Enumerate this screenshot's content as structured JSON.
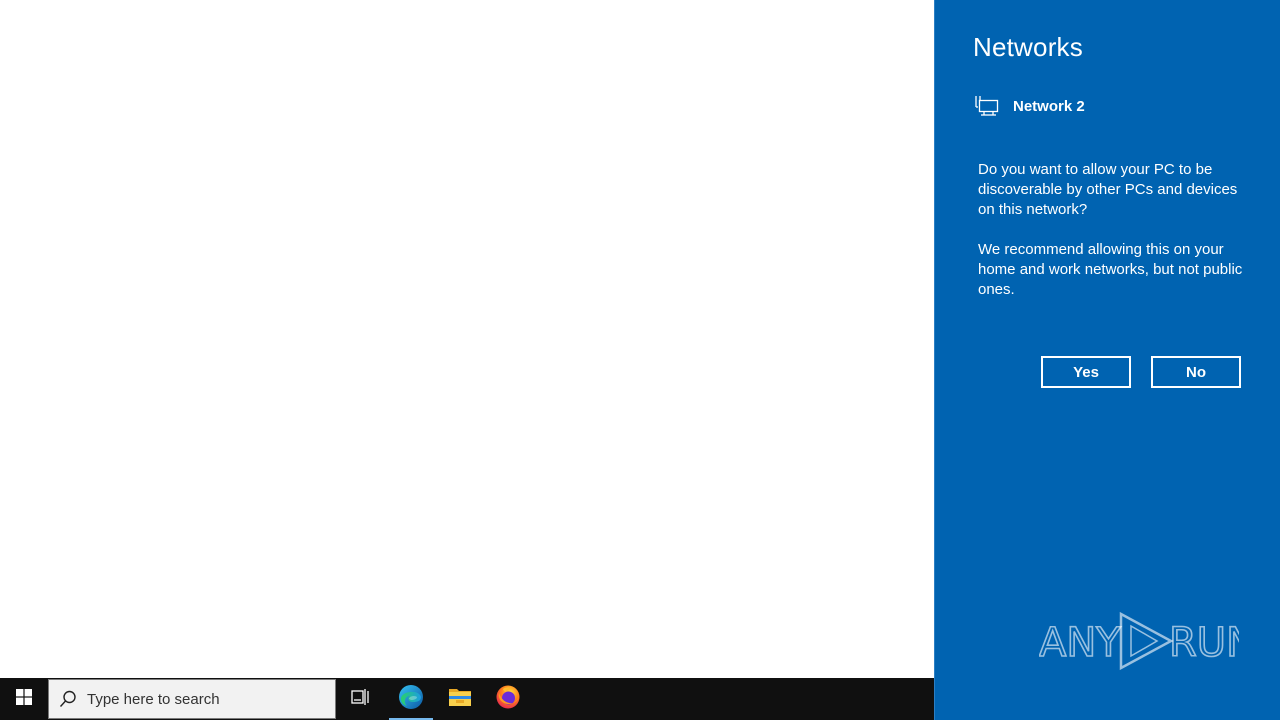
{
  "network_panel": {
    "title": "Networks",
    "network_name": "Network 2",
    "network_icon": "ethernet-icon",
    "question": "Do you want to allow your PC to be discoverable by other PCs and devices on this network?",
    "recommendation": "We recommend allowing this on your home and work networks, but not public ones.",
    "yes_label": "Yes",
    "no_label": "No",
    "background_color": "#0063b1"
  },
  "watermark": {
    "text": "ANY RUN"
  },
  "taskbar": {
    "search_placeholder": "Type here to search",
    "icons": [
      "windows-start-icon",
      "search-icon",
      "task-view-icon",
      "edge-icon",
      "file-explorer-icon",
      "firefox-icon"
    ],
    "background_color": "#101010"
  }
}
